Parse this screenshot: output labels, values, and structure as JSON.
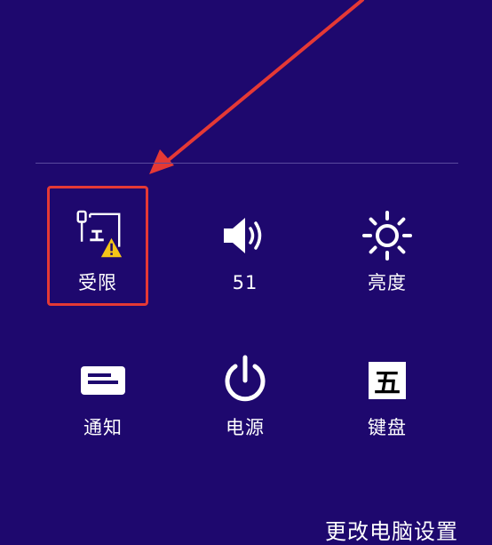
{
  "tiles": [
    {
      "label": "受限",
      "icon": "network-limited-icon"
    },
    {
      "label": "51",
      "icon": "volume-icon"
    },
    {
      "label": "亮度",
      "icon": "brightness-icon"
    },
    {
      "label": "通知",
      "icon": "notifications-icon"
    },
    {
      "label": "电源",
      "icon": "power-icon"
    },
    {
      "label": "键盘",
      "icon": "keyboard-ime-icon",
      "ime_char": "五"
    }
  ],
  "footer": {
    "change_settings_label": "更改电脑设置"
  },
  "colors": {
    "background": "#1e086e",
    "annotation": "#e53935",
    "warning": "#f5c518"
  }
}
